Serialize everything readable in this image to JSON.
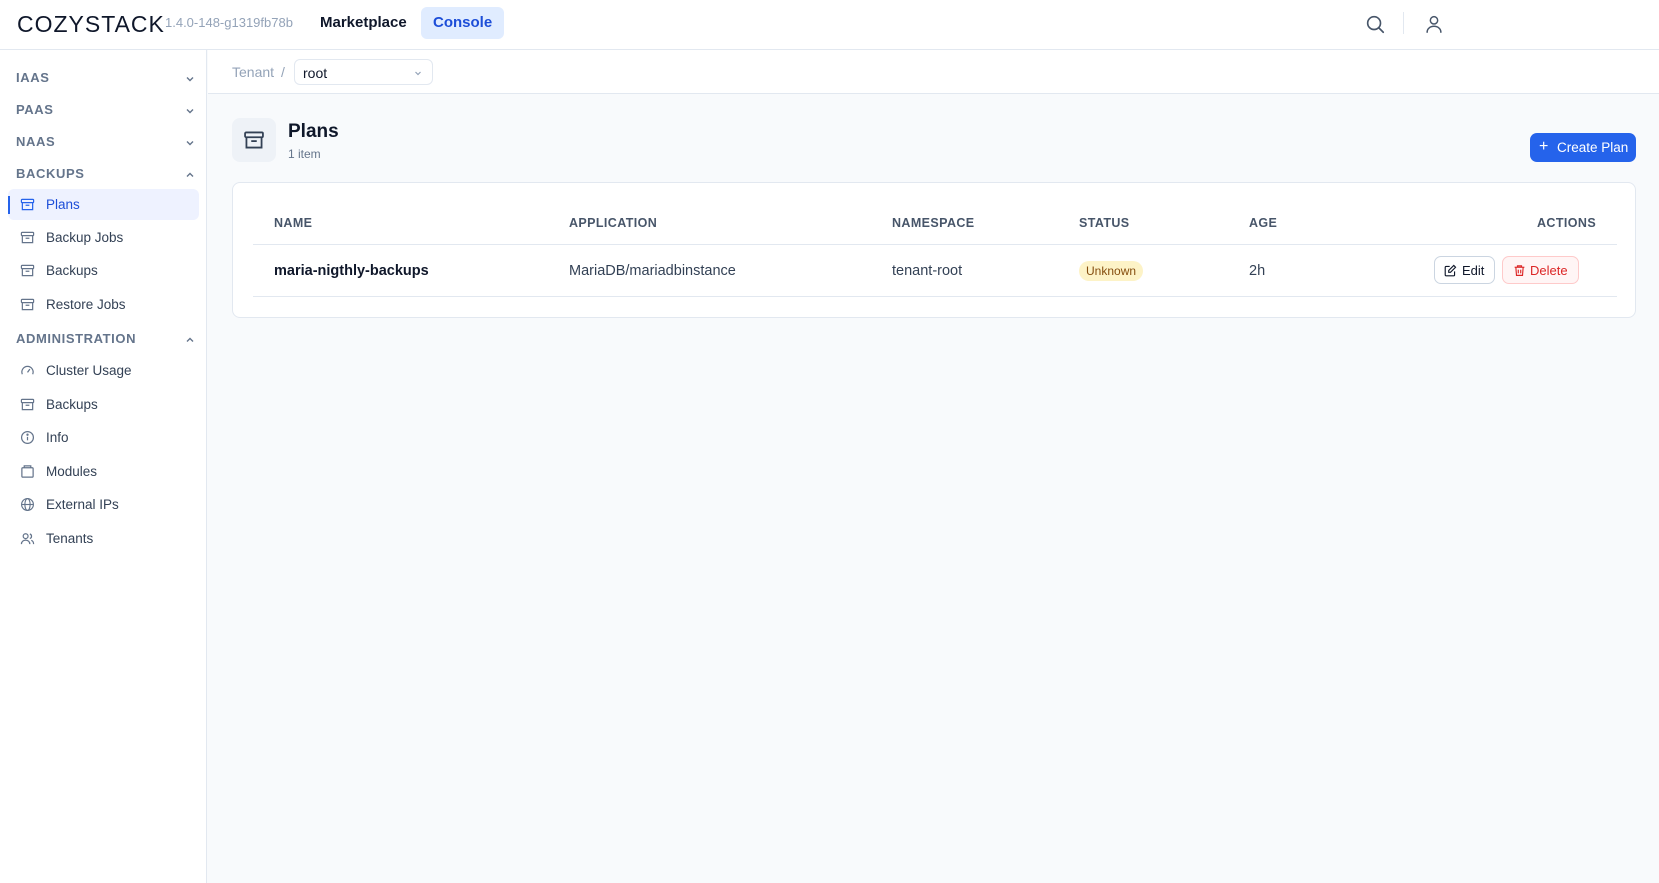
{
  "header": {
    "logo": "COZYSTACK",
    "version": "1.4.0-148-g1319fb78b",
    "nav": [
      {
        "label": "Marketplace"
      },
      {
        "label": "Console"
      }
    ]
  },
  "sidebar": {
    "sections": [
      {
        "label": "IAAS"
      },
      {
        "label": "PAAS"
      },
      {
        "label": "NAAS"
      },
      {
        "label": "BACKUPS"
      },
      {
        "label": "ADMINISTRATION"
      }
    ],
    "backups_items": [
      {
        "label": "Plans",
        "icon": "archive-icon"
      },
      {
        "label": "Backup Jobs",
        "icon": "archive-icon"
      },
      {
        "label": "Backups",
        "icon": "archive-icon"
      },
      {
        "label": "Restore Jobs",
        "icon": "archive-icon"
      }
    ],
    "admin_items": [
      {
        "label": "Cluster Usage",
        "icon": "gauge-icon"
      },
      {
        "label": "Backups",
        "icon": "archive-icon"
      },
      {
        "label": "Info",
        "icon": "info-icon"
      },
      {
        "label": "Modules",
        "icon": "package-icon"
      },
      {
        "label": "External IPs",
        "icon": "globe-icon"
      },
      {
        "label": "Tenants",
        "icon": "users-icon"
      }
    ]
  },
  "breadcrumb": {
    "label": "Tenant",
    "separator": "/",
    "tenant": "root"
  },
  "page": {
    "title": "Plans",
    "count": "1 item",
    "create_button": "Create Plan"
  },
  "table": {
    "columns": [
      "NAME",
      "APPLICATION",
      "NAMESPACE",
      "STATUS",
      "AGE",
      "ACTIONS"
    ],
    "rows": [
      {
        "name": "maria-nigthly-backups",
        "application": "MariaDB/mariadbinstance",
        "namespace": "tenant-root",
        "status": "Unknown",
        "age": "2h",
        "edit": "Edit",
        "delete": "Delete"
      }
    ]
  },
  "colors": {
    "accent": "#2563eb",
    "status_unknown_bg": "#fdf3c7",
    "danger": "#dc2626"
  }
}
